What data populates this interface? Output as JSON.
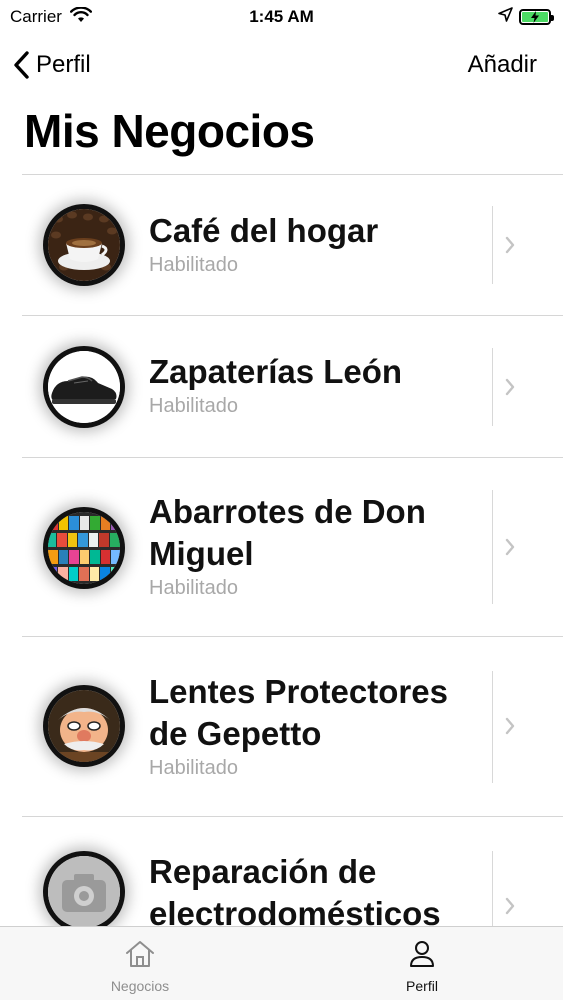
{
  "status_bar": {
    "carrier": "Carrier",
    "time": "1:45 AM"
  },
  "nav": {
    "back_label": "Perfil",
    "add_label": "Añadir",
    "title": "Mis Negocios"
  },
  "businesses": [
    {
      "name": "Café del hogar",
      "status": "Habilitado",
      "image": "coffee-cup-image"
    },
    {
      "name": "Zapaterías León",
      "status": "Habilitado",
      "image": "shoe-image"
    },
    {
      "name": "Abarrotes de Don Miguel",
      "status": "Habilitado",
      "image": "grocery-shelf-image"
    },
    {
      "name": "Lentes Protectores de Gepetto",
      "status": "Habilitado",
      "image": "gepetto-image"
    },
    {
      "name": "Reparación de electrodomésticos",
      "status": "",
      "image": "camera-placeholder-image"
    }
  ],
  "tab_bar": {
    "tabs": [
      {
        "label": "Negocios",
        "icon": "house-icon",
        "selected": false
      },
      {
        "label": "Perfil",
        "icon": "person-icon",
        "selected": true
      }
    ]
  },
  "colors": {
    "accent": "#000000",
    "subtitle": "#a8a8a8",
    "battery": "#4cd964"
  }
}
